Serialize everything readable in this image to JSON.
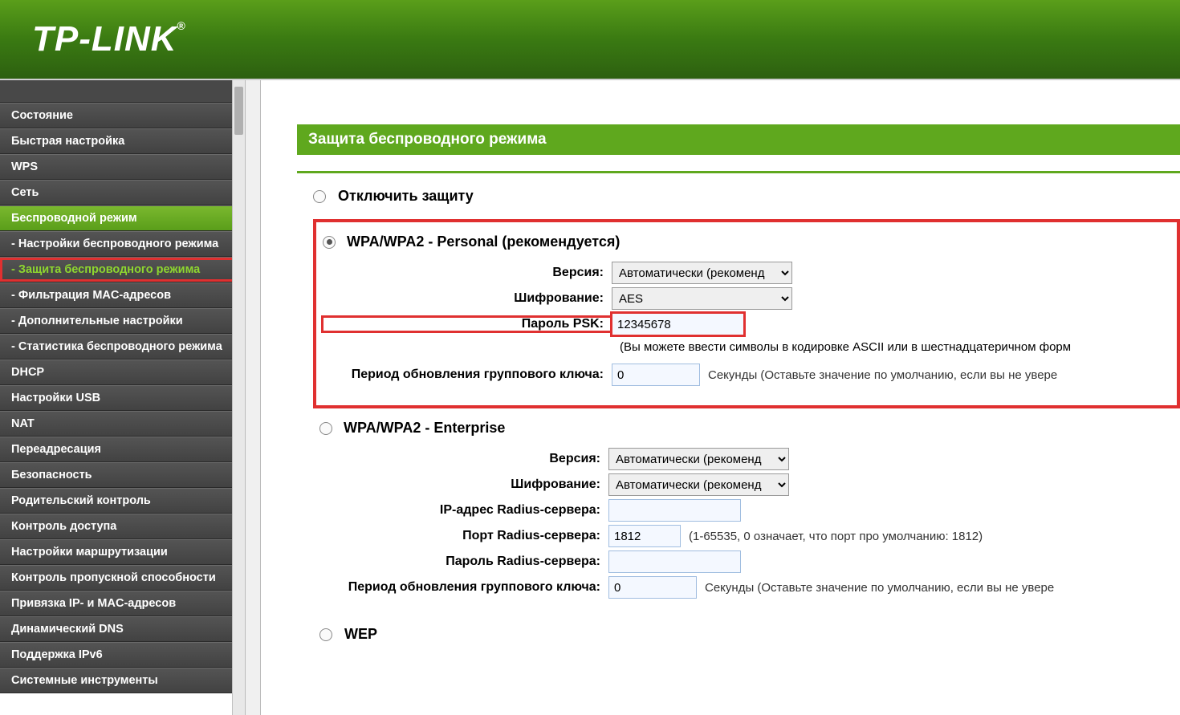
{
  "brand": "TP-LINK",
  "page_title": "Защита беспроводного режима",
  "sidebar": {
    "items": [
      {
        "label": "Состояние"
      },
      {
        "label": "Быстрая настройка"
      },
      {
        "label": "WPS"
      },
      {
        "label": "Сеть"
      },
      {
        "label": "Беспроводной режим",
        "active_parent": true
      },
      {
        "label": "- Настройки беспроводного режима"
      },
      {
        "label": "- Защита беспроводного режима",
        "active_sub": true,
        "highlighted": true
      },
      {
        "label": "- Фильтрация MAC-адресов"
      },
      {
        "label": "- Дополнительные настройки"
      },
      {
        "label": "- Статистика беспроводного режима"
      },
      {
        "label": "DHCP"
      },
      {
        "label": "Настройки USB"
      },
      {
        "label": "NAT"
      },
      {
        "label": "Переадресация"
      },
      {
        "label": "Безопасность"
      },
      {
        "label": "Родительский контроль"
      },
      {
        "label": "Контроль доступа"
      },
      {
        "label": "Настройки маршрутизации"
      },
      {
        "label": "Контроль пропускной способности"
      },
      {
        "label": "Привязка IP- и MAC-адресов"
      },
      {
        "label": "Динамический DNS"
      },
      {
        "label": "Поддержка IPv6"
      },
      {
        "label": "Системные инструменты"
      }
    ]
  },
  "sections": {
    "disable": {
      "label": "Отключить защиту",
      "checked": false
    },
    "wpa_personal": {
      "label": "WPA/WPA2 - Personal (рекомендуется)",
      "checked": true,
      "version_label": "Версия:",
      "version_value": "Автоматически (рекоменд",
      "encryption_label": "Шифрование:",
      "encryption_value": "AES",
      "psk_label": "Пароль PSK:",
      "psk_value": "12345678",
      "psk_hint": "(Вы можете ввести символы в кодировке ASCII или в шестнадцатеричном форм",
      "gku_label": "Период обновления группового ключа:",
      "gku_value": "0",
      "gku_hint": "Секунды (Оставьте значение по умолчанию, если вы не увере"
    },
    "wpa_enterprise": {
      "label": "WPA/WPA2 - Enterprise",
      "checked": false,
      "version_label": "Версия:",
      "version_value": "Автоматически (рекоменд",
      "encryption_label": "Шифрование:",
      "encryption_value": "Автоматически (рекоменд",
      "radius_ip_label": "IP-адрес Radius-сервера:",
      "radius_ip_value": "",
      "radius_port_label": "Порт Radius-сервера:",
      "radius_port_value": "1812",
      "radius_port_hint": "(1-65535, 0 означает, что порт про умолчанию: 1812)",
      "radius_pass_label": "Пароль Radius-сервера:",
      "radius_pass_value": "",
      "gku_label": "Период обновления группового ключа:",
      "gku_value": "0",
      "gku_hint": "Секунды (Оставьте значение по умолчанию, если вы не увере"
    },
    "wep": {
      "label": "WEP",
      "checked": false
    }
  }
}
